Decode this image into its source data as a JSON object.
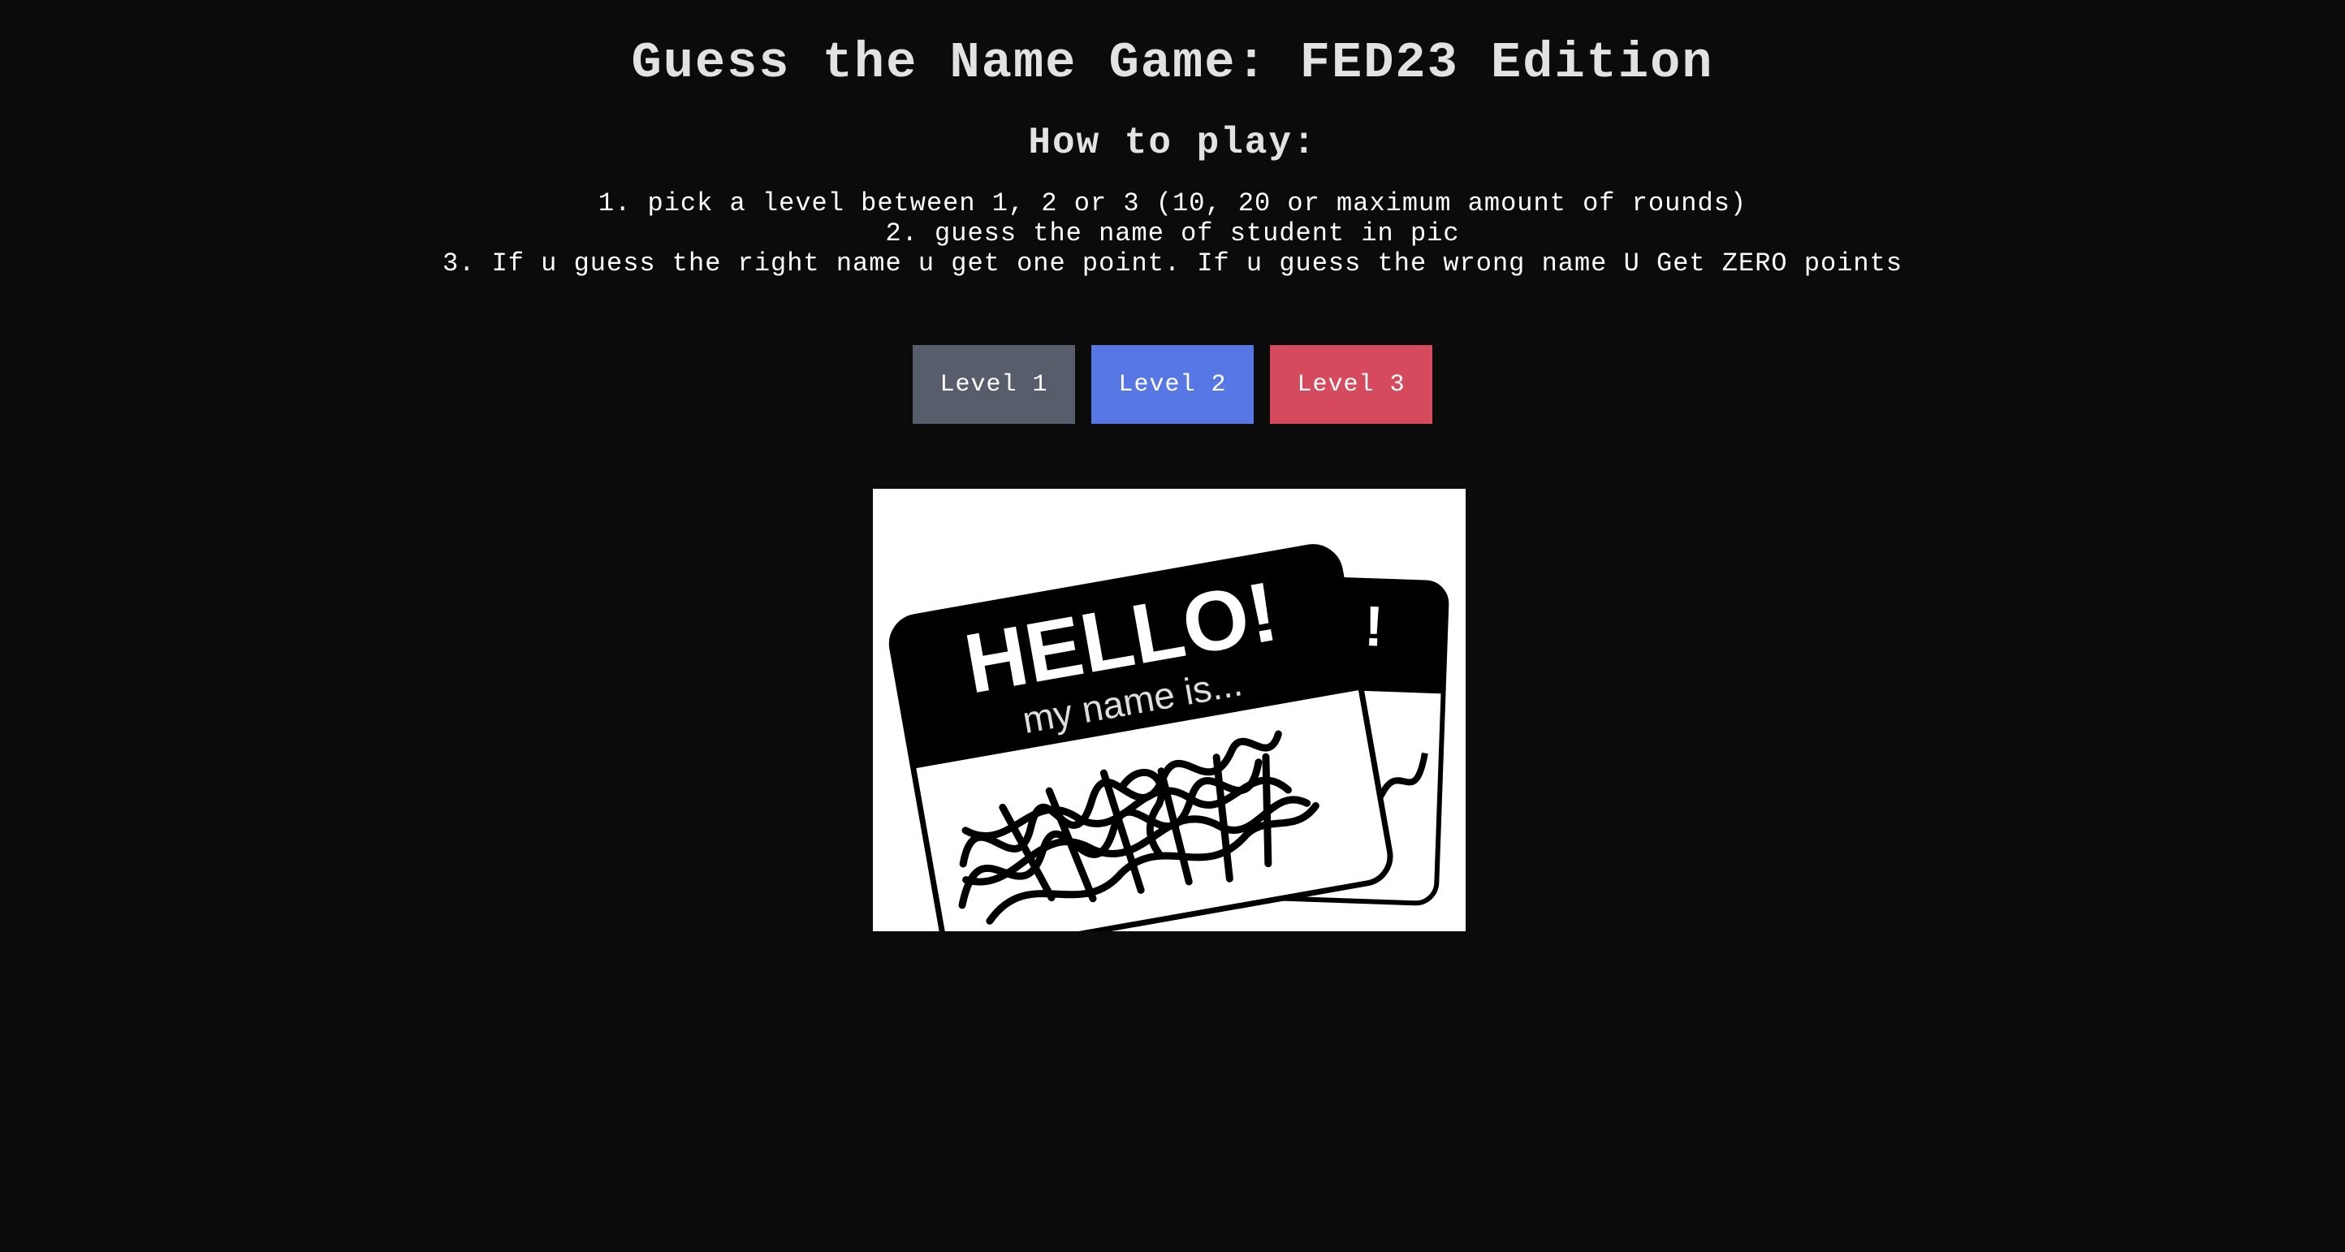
{
  "header": {
    "title": "Guess the Name Game: FED23 Edition",
    "subtitle": "How to play:"
  },
  "rules": [
    "1. pick a level between 1, 2 or 3 (10, 20 or maximum amount of rounds)",
    "2. guess the name of student in pic",
    "3. If u guess the right name u get one point. If u guess the wrong name U Get ZERO points"
  ],
  "levels": [
    {
      "label": "Level 1",
      "color": "#585d6c",
      "text_color": "#ffffff"
    },
    {
      "label": "Level 2",
      "color": "#5778e4",
      "text_color": "#ffffff"
    },
    {
      "label": "Level 3",
      "color": "#d54b5d",
      "text_color": "#ffffff"
    }
  ],
  "picture": {
    "sticker_heading": "HELLO!",
    "sticker_sub": "my name is...",
    "sticker_back_mark": "!"
  }
}
